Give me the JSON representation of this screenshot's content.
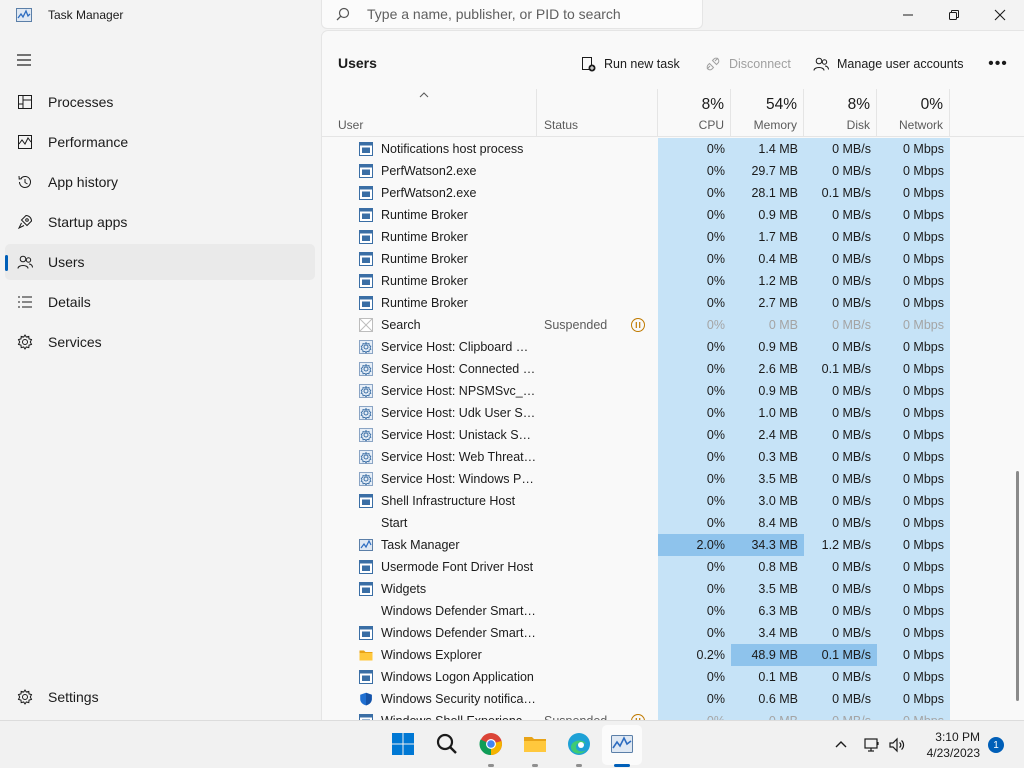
{
  "window": {
    "title": "Task Manager",
    "search_placeholder": "Type a name, publisher, or PID to search"
  },
  "sidebar": {
    "items": [
      {
        "label": "Processes",
        "icon": "processes-icon"
      },
      {
        "label": "Performance",
        "icon": "performance-icon"
      },
      {
        "label": "App history",
        "icon": "app-history-icon"
      },
      {
        "label": "Startup apps",
        "icon": "startup-apps-icon"
      },
      {
        "label": "Users",
        "icon": "users-icon",
        "active": true
      },
      {
        "label": "Details",
        "icon": "details-icon"
      },
      {
        "label": "Services",
        "icon": "services-icon"
      }
    ],
    "settings_label": "Settings"
  },
  "page": {
    "title": "Users",
    "run_new_task": "Run new task",
    "disconnect": "Disconnect",
    "manage_accounts": "Manage user accounts",
    "more": "•••"
  },
  "columns": {
    "user": "User",
    "status": "Status",
    "cpu_pct": "8%",
    "cpu": "CPU",
    "memory_pct": "54%",
    "memory": "Memory",
    "disk_pct": "8%",
    "disk": "Disk",
    "network_pct": "0%",
    "network": "Network"
  },
  "rows": [
    {
      "name": "Notifications host process",
      "icon": "app-window-icon",
      "status": "",
      "cpu": "0%",
      "mem": "1.4 MB",
      "disk": "0 MB/s",
      "net": "0 Mbps"
    },
    {
      "name": "PerfWatson2.exe",
      "icon": "app-window-icon",
      "status": "",
      "cpu": "0%",
      "mem": "29.7 MB",
      "disk": "0 MB/s",
      "net": "0 Mbps"
    },
    {
      "name": "PerfWatson2.exe",
      "icon": "app-window-icon",
      "status": "",
      "cpu": "0%",
      "mem": "28.1 MB",
      "disk": "0.1 MB/s",
      "net": "0 Mbps"
    },
    {
      "name": "Runtime Broker",
      "icon": "app-window-icon",
      "status": "",
      "cpu": "0%",
      "mem": "0.9 MB",
      "disk": "0 MB/s",
      "net": "0 Mbps"
    },
    {
      "name": "Runtime Broker",
      "icon": "app-window-icon",
      "status": "",
      "cpu": "0%",
      "mem": "1.7 MB",
      "disk": "0 MB/s",
      "net": "0 Mbps"
    },
    {
      "name": "Runtime Broker",
      "icon": "app-window-icon",
      "status": "",
      "cpu": "0%",
      "mem": "0.4 MB",
      "disk": "0 MB/s",
      "net": "0 Mbps"
    },
    {
      "name": "Runtime Broker",
      "icon": "app-window-icon",
      "status": "",
      "cpu": "0%",
      "mem": "1.2 MB",
      "disk": "0 MB/s",
      "net": "0 Mbps"
    },
    {
      "name": "Runtime Broker",
      "icon": "app-window-icon",
      "status": "",
      "cpu": "0%",
      "mem": "2.7 MB",
      "disk": "0 MB/s",
      "net": "0 Mbps"
    },
    {
      "name": "Search",
      "icon": "search-app-icon",
      "status": "Suspended",
      "suspended": true,
      "cpu": "0%",
      "mem": "0 MB",
      "disk": "0 MB/s",
      "net": "0 Mbps"
    },
    {
      "name": "Service Host: Clipboard Us...",
      "icon": "gear-icon",
      "status": "",
      "cpu": "0%",
      "mem": "0.9 MB",
      "disk": "0 MB/s",
      "net": "0 Mbps"
    },
    {
      "name": "Service Host: Connected D...",
      "icon": "gear-icon",
      "status": "",
      "cpu": "0%",
      "mem": "2.6 MB",
      "disk": "0.1 MB/s",
      "net": "0 Mbps"
    },
    {
      "name": "Service Host: NPSMSvc_34...",
      "icon": "gear-icon",
      "status": "",
      "cpu": "0%",
      "mem": "0.9 MB",
      "disk": "0 MB/s",
      "net": "0 Mbps"
    },
    {
      "name": "Service Host: Udk User Ser...",
      "icon": "gear-icon",
      "status": "",
      "cpu": "0%",
      "mem": "1.0 MB",
      "disk": "0 MB/s",
      "net": "0 Mbps"
    },
    {
      "name": "Service Host: Unistack Serv...",
      "icon": "gear-icon",
      "status": "",
      "cpu": "0%",
      "mem": "2.4 MB",
      "disk": "0 MB/s",
      "net": "0 Mbps"
    },
    {
      "name": "Service Host: Web Threat ...",
      "icon": "gear-icon",
      "status": "",
      "cpu": "0%",
      "mem": "0.3 MB",
      "disk": "0 MB/s",
      "net": "0 Mbps"
    },
    {
      "name": "Service Host: Windows Pu...",
      "icon": "gear-icon",
      "status": "",
      "cpu": "0%",
      "mem": "3.5 MB",
      "disk": "0 MB/s",
      "net": "0 Mbps"
    },
    {
      "name": "Shell Infrastructure Host",
      "icon": "app-window-icon",
      "status": "",
      "cpu": "0%",
      "mem": "3.0 MB",
      "disk": "0 MB/s",
      "net": "0 Mbps"
    },
    {
      "name": "Start",
      "icon": "",
      "status": "",
      "cpu": "0%",
      "mem": "8.4 MB",
      "disk": "0 MB/s",
      "net": "0 Mbps"
    },
    {
      "name": "Task Manager",
      "icon": "task-manager-icon",
      "status": "",
      "cpu": "2.0%",
      "mem": "34.3 MB",
      "disk": "1.2 MB/s",
      "net": "0 Mbps",
      "hot_cpu": true,
      "hot_mem": true
    },
    {
      "name": "Usermode Font Driver Host",
      "icon": "app-window-icon",
      "status": "",
      "cpu": "0%",
      "mem": "0.8 MB",
      "disk": "0 MB/s",
      "net": "0 Mbps"
    },
    {
      "name": "Widgets",
      "icon": "app-window-icon",
      "status": "",
      "cpu": "0%",
      "mem": "3.5 MB",
      "disk": "0 MB/s",
      "net": "0 Mbps"
    },
    {
      "name": "Windows Defender SmartS...",
      "icon": "",
      "status": "",
      "cpu": "0%",
      "mem": "6.3 MB",
      "disk": "0 MB/s",
      "net": "0 Mbps"
    },
    {
      "name": "Windows Defender SmartS...",
      "icon": "app-window-icon",
      "status": "",
      "cpu": "0%",
      "mem": "3.4 MB",
      "disk": "0 MB/s",
      "net": "0 Mbps"
    },
    {
      "name": "Windows Explorer",
      "icon": "folder-icon",
      "status": "",
      "cpu": "0.2%",
      "mem": "48.9 MB",
      "disk": "0.1 MB/s",
      "net": "0 Mbps",
      "hot_mem": true,
      "hot_disk": true
    },
    {
      "name": "Windows Logon Application",
      "icon": "app-window-icon",
      "status": "",
      "cpu": "0%",
      "mem": "0.1 MB",
      "disk": "0 MB/s",
      "net": "0 Mbps"
    },
    {
      "name": "Windows Security notificat...",
      "icon": "shield-icon",
      "status": "",
      "cpu": "0%",
      "mem": "0.6 MB",
      "disk": "0 MB/s",
      "net": "0 Mbps"
    },
    {
      "name": "Windows Shell Experience ...",
      "icon": "app-window-icon",
      "status": "Suspended",
      "suspended": true,
      "cpu": "0%",
      "mem": "0 MB",
      "disk": "0 MB/s",
      "net": "0 Mbps"
    }
  ],
  "taskbar": {
    "time": "3:10 PM",
    "date": "4/23/2023",
    "notifications": "1",
    "apps": [
      "windows-start-icon",
      "search-icon",
      "chrome-icon",
      "file-explorer-icon",
      "edge-icon",
      "task-manager-icon"
    ]
  },
  "colors": {
    "accent": "#005fb8",
    "heat_low": "#c6e3f7",
    "heat_mid": "#a6d2f2",
    "heat_high": "#8ec3ec",
    "suspended_icon": "#c07a00"
  }
}
